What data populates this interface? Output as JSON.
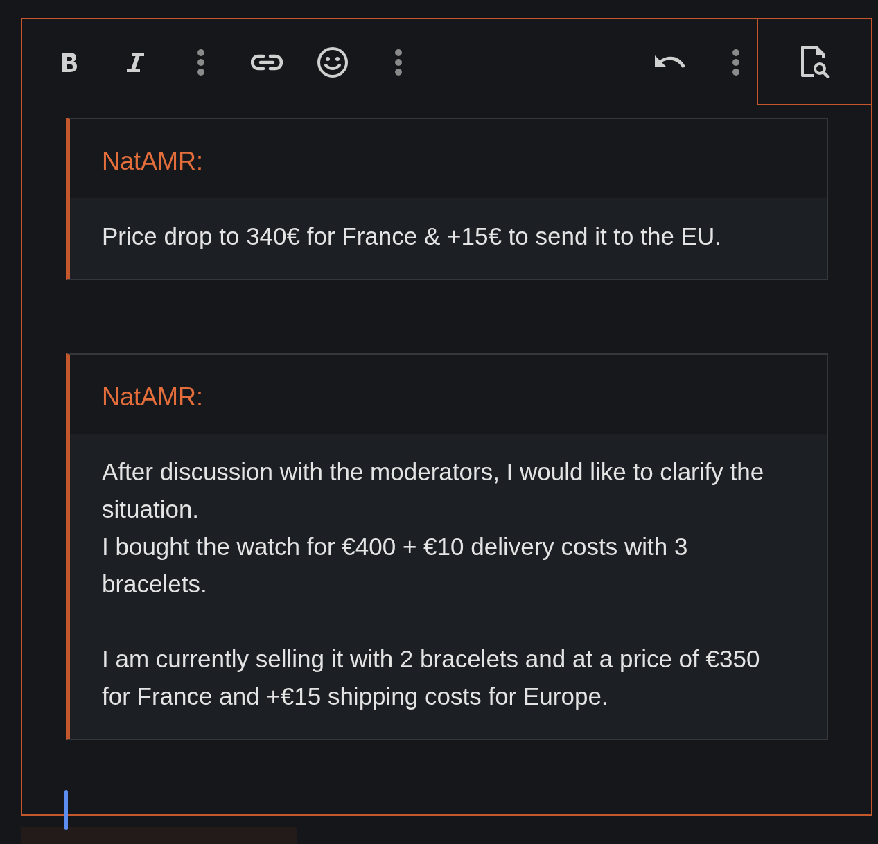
{
  "toolbar": [
    {
      "kind": "bold"
    },
    {
      "kind": "italic"
    },
    {
      "kind": "more"
    },
    {
      "kind": "link"
    },
    {
      "kind": "emoji"
    },
    {
      "kind": "more"
    },
    {
      "kind": "spacer"
    },
    {
      "kind": "undo"
    },
    {
      "kind": "more"
    },
    {
      "kind": "preview"
    }
  ],
  "quotes": [
    {
      "author": "NatAMR:",
      "paragraphs": [
        [
          "Price drop to 340€ for France & +15€ to send it to the EU."
        ]
      ]
    },
    {
      "author": "NatAMR:",
      "paragraphs": [
        [
          "After discussion with the moderators, I would like to clarify the situation.",
          "I bought the watch for €400 + €10 delivery costs with 3 bracelets."
        ],
        [
          "I am currently selling it with 2 bracelets and at a price of €350 for France and +€15 shipping costs for Europe."
        ]
      ]
    }
  ]
}
